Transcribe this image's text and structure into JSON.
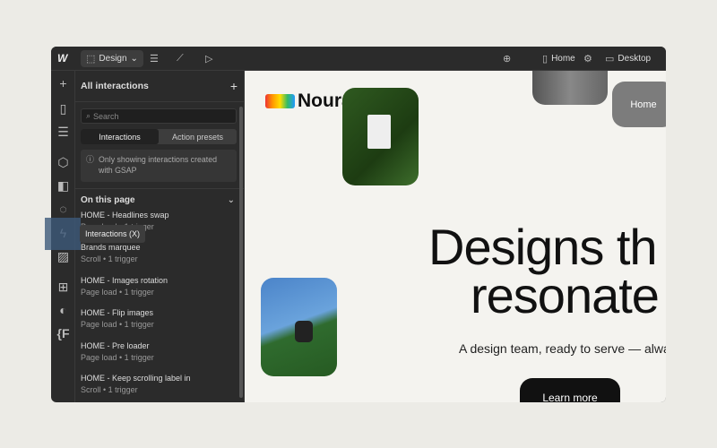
{
  "toolbar": {
    "mode": "Design",
    "page": "Home",
    "breakpoint": "Desktop"
  },
  "panel": {
    "title": "All interactions",
    "search_placeholder": "Search",
    "tabs": [
      "Interactions",
      "Action presets"
    ],
    "note": "Only showing interactions created with GSAP",
    "section": "On this page",
    "items": [
      {
        "title": "HOME - Headlines swap",
        "sub": "Page load • 1 trigger"
      },
      {
        "title": "Brands marquee",
        "sub": "Scroll • 1 trigger"
      },
      {
        "title": "HOME - Images rotation",
        "sub": "Page load • 1 trigger"
      },
      {
        "title": "HOME - Flip images",
        "sub": "Page load • 1 trigger"
      },
      {
        "title": "HOME - Pre loader",
        "sub": "Page load • 1 trigger"
      },
      {
        "title": "HOME - Keep scrolling label in",
        "sub": "Scroll • 1 trigger"
      }
    ]
  },
  "tooltip": "Interactions (X)",
  "canvas": {
    "brand": "Noura",
    "home_button": "Home",
    "headline_1": "Designs th",
    "headline_2": "resonate",
    "subtitle": "A design team, ready to serve — alwa",
    "cta": "Learn more"
  }
}
